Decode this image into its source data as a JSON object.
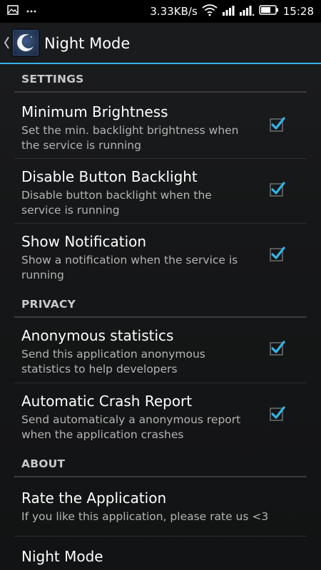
{
  "status_bar": {
    "notification_icon": "image-icon",
    "more_icon": "ellipsis-icon",
    "network_speed": "3.33KB/s",
    "wifi_icon": "wifi-icon",
    "signal_icon": "signal-icon",
    "signal2_icon": "signal-3g-icon",
    "battery_icon": "battery-icon",
    "time": "15:28"
  },
  "action_bar": {
    "back_icon": "chevron-left-icon",
    "app_icon": "moon-icon",
    "title": "Night Mode"
  },
  "colors": {
    "accent": "#33b5e5",
    "background": "#151617",
    "divider": "#3a3b3d"
  },
  "sections": [
    {
      "header": "SETTINGS",
      "items": [
        {
          "title": "Minimum Brightness",
          "summary": "Set the min. backlight brightness when the service is running",
          "checked": true
        },
        {
          "title": "Disable Button Backlight",
          "summary": "Disable button backlight when the service is running",
          "checked": true
        },
        {
          "title": "Show Notification",
          "summary": "Show a notification when the service is running",
          "checked": true
        }
      ]
    },
    {
      "header": "PRIVACY",
      "items": [
        {
          "title": "Anonymous statistics",
          "summary": "Send this application anonymous statistics to help developers",
          "checked": true
        },
        {
          "title": "Automatic Crash Report",
          "summary": "Send automaticaly a anonymous report when the application crashes",
          "checked": true
        }
      ]
    },
    {
      "header": "ABOUT",
      "items": [
        {
          "title": "Rate the Application",
          "summary": "If you like this application, please rate us <3"
        },
        {
          "title": "Night Mode"
        }
      ]
    }
  ]
}
